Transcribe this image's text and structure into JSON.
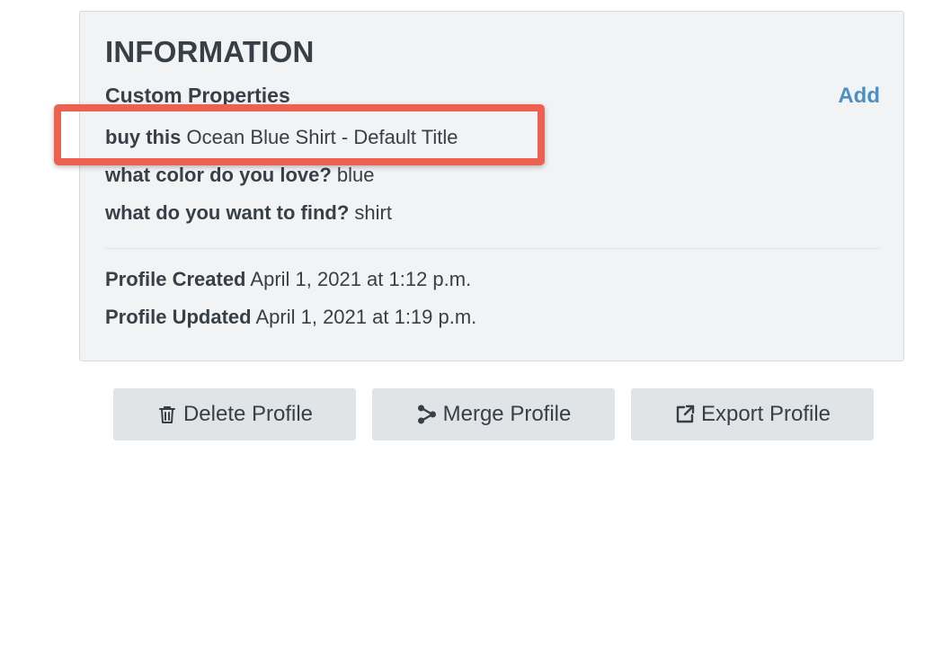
{
  "info": {
    "title": "INFORMATION",
    "custom_properties_label": "Custom Properties",
    "add_label": "Add",
    "properties": [
      {
        "key": "buy this",
        "value": "Ocean Blue Shirt - Default Title"
      },
      {
        "key": "what color do you love?",
        "value": "blue"
      },
      {
        "key": "what do you want to find?",
        "value": "shirt"
      }
    ],
    "meta": [
      {
        "key": "Profile Created",
        "value": "April 1, 2021 at 1:12 p.m."
      },
      {
        "key": "Profile Updated",
        "value": "April 1, 2021 at 1:19 p.m."
      }
    ]
  },
  "actions": {
    "delete_label": "Delete Profile",
    "merge_label": "Merge Profile",
    "export_label": "Export Profile"
  },
  "icons": {
    "delete": "trash-icon",
    "merge": "merge-icon",
    "export": "export-icon"
  },
  "colors": {
    "link": "#4a90c6",
    "highlight": "#ec6150",
    "card_bg": "#f2f3f5",
    "button_bg": "#e1e4e7",
    "text": "#373f47"
  }
}
